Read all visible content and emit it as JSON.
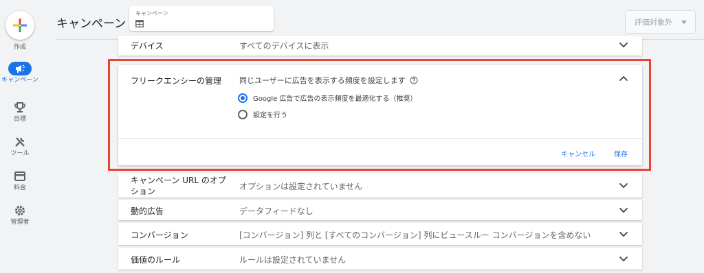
{
  "nav": {
    "create_label": "作成",
    "items": [
      {
        "label": "キャンペーン",
        "icon": "megaphone-icon",
        "active": true
      },
      {
        "label": "目標",
        "icon": "trophy-icon",
        "active": false
      },
      {
        "label": "ツール",
        "icon": "tools-icon",
        "active": false
      },
      {
        "label": "料金",
        "icon": "credit-card-icon",
        "active": false
      },
      {
        "label": "管理者",
        "icon": "gear-icon",
        "active": false
      }
    ]
  },
  "header": {
    "title": "キャンペーン",
    "campaign_selector_label": "キャンペーン",
    "eval_button": "評価対象外"
  },
  "rows": {
    "device": {
      "label": "デバイス",
      "value": "すべてのデバイスに表示"
    },
    "url_options": {
      "label": "キャンペーン URL のオプション",
      "value": "オプションは設定されていません"
    },
    "dynamic_ads": {
      "label": "動的広告",
      "value": "データフィードなし"
    },
    "conversion": {
      "label": "コンバージョン",
      "value": "[コンバージョン] 列と [すべてのコンバージョン] 列にビュースルー コンバージョンを含めない"
    },
    "value_rules": {
      "label": "価値のルール",
      "value": "ルールは設定されていません"
    }
  },
  "frequency": {
    "title": "フリークエンシーの管理",
    "description": "同じユーザーに広告を表示する頻度を設定します",
    "option_google": "Google 広告で広告の表示頻度を最適化する（推奨）",
    "option_manual": "設定を行う",
    "selected": "google",
    "cancel_label": "キャンセル",
    "save_label": "保存"
  },
  "colors": {
    "accent": "#1a73e8",
    "highlight": "#ea4335"
  }
}
